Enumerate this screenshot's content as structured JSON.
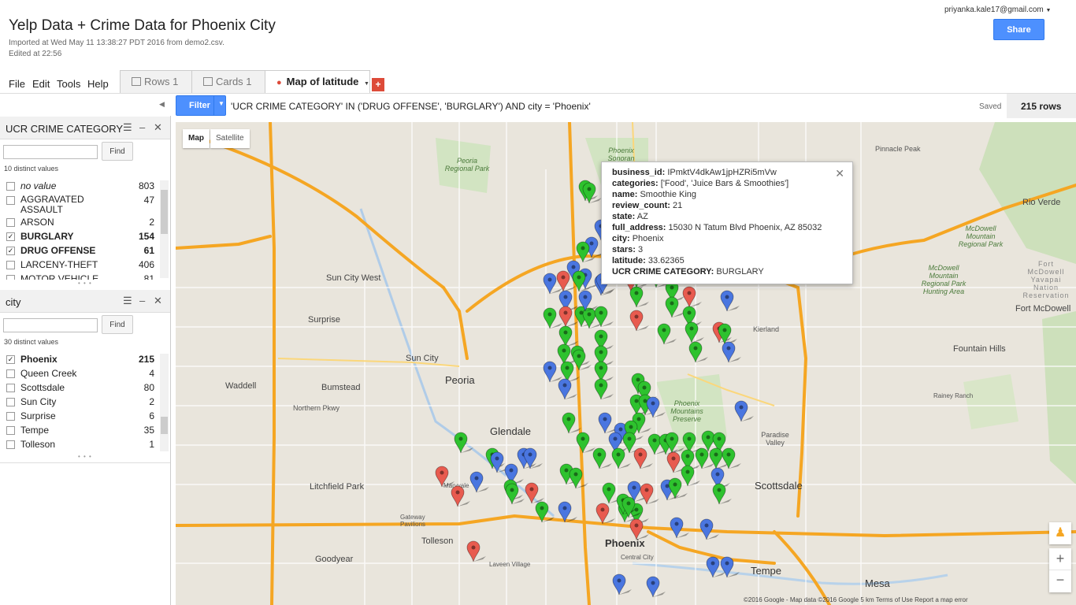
{
  "header": {
    "title": "Yelp Data + Crime Data for Phoenix City",
    "imported": "Imported at Wed May 11 13:38:27 PDT 2016 from demo2.csv.",
    "edited": "Edited at 22:56",
    "user": "priyanka.kale17@gmail.com",
    "share_label": "Share"
  },
  "menu": [
    "File",
    "Edit",
    "Tools",
    "Help"
  ],
  "tabs": [
    {
      "label": "Rows 1",
      "icon": "rows-icon"
    },
    {
      "label": "Cards 1",
      "icon": "cards-icon"
    },
    {
      "label": "Map of latitude",
      "icon": "map-pin-icon"
    }
  ],
  "filter": {
    "button_label": "Filter",
    "query": "'UCR CRIME CATEGORY' IN ('DRUG OFFENSE', 'BURGLARY') AND city = 'Phoenix'",
    "saved": "Saved",
    "rows": "215 rows"
  },
  "panels": [
    {
      "title": "UCR CRIME CATEGORY",
      "find": "Find",
      "distinct": "10 distinct values",
      "values": [
        {
          "name": "no value",
          "count": "803",
          "checked": false
        },
        {
          "name": "AGGRAVATED ASSAULT",
          "count": "47",
          "checked": false
        },
        {
          "name": "ARSON",
          "count": "2",
          "checked": false
        },
        {
          "name": "BURGLARY",
          "count": "154",
          "checked": true
        },
        {
          "name": "DRUG OFFENSE",
          "count": "61",
          "checked": true
        },
        {
          "name": "LARCENY-THEFT",
          "count": "406",
          "checked": false
        },
        {
          "name": "MOTOR VEHICLE",
          "count": "81",
          "checked": false
        }
      ]
    },
    {
      "title": "city",
      "find": "Find",
      "distinct": "30 distinct values",
      "values": [
        {
          "name": "Phoenix",
          "count": "215",
          "checked": true
        },
        {
          "name": "Queen Creek",
          "count": "4",
          "checked": false
        },
        {
          "name": "Scottsdale",
          "count": "80",
          "checked": false
        },
        {
          "name": "Sun City",
          "count": "2",
          "checked": false
        },
        {
          "name": "Surprise",
          "count": "6",
          "checked": false
        },
        {
          "name": "Tempe",
          "count": "35",
          "checked": false
        },
        {
          "name": "Tolleson",
          "count": "1",
          "checked": false
        }
      ]
    }
  ],
  "map": {
    "type_map": "Map",
    "type_satellite": "Satellite",
    "places": [
      "Peoria",
      "Glendale",
      "Phoenix",
      "Scottsdale",
      "Tempe",
      "Mesa",
      "Sun City",
      "Sun City West",
      "Surprise",
      "Waddell",
      "Bumstead",
      "Litchfield Park",
      "Goodyear",
      "Tolleson",
      "Paradise Valley",
      "Fountain Hills",
      "Fort McDowell",
      "Rio Verde",
      "Pinnacle Peak",
      "Kierland",
      "Northern Pkwy",
      "Phoenix Mountains Preserve",
      "Peoria Regional Park",
      "McDowell Mountain Regional Park",
      "McDowell Mountain Regional Park Hunting Area",
      "Fort McDowell Yavapai Nation Reservation",
      "Gateway Pavilions",
      "Central City",
      "Phoenix Sonoran Preserve",
      "Maryvale",
      "Laveen Village",
      "Rainey Ranch"
    ],
    "popup": {
      "business_id": "IPmktV4dkAw1jpHZRi5mVw",
      "categories": "['Food', 'Juice Bars & Smoothies']",
      "name": "Smoothie King",
      "review_count": "21",
      "state": "AZ",
      "full_address": "15030 N Tatum Blvd Phoenix, AZ 85032",
      "city": "Phoenix",
      "stars": "3",
      "latitude": "33.62365",
      "ucr": "BURGLARY"
    },
    "footer": "©2016 Google - Map data ©2016 Google    5 km          Terms of Use   Report a map error",
    "colors": {
      "green": "#2ec22e",
      "blue": "#4a76e0",
      "red": "#e85b4f",
      "highway": "#f5a623"
    }
  }
}
